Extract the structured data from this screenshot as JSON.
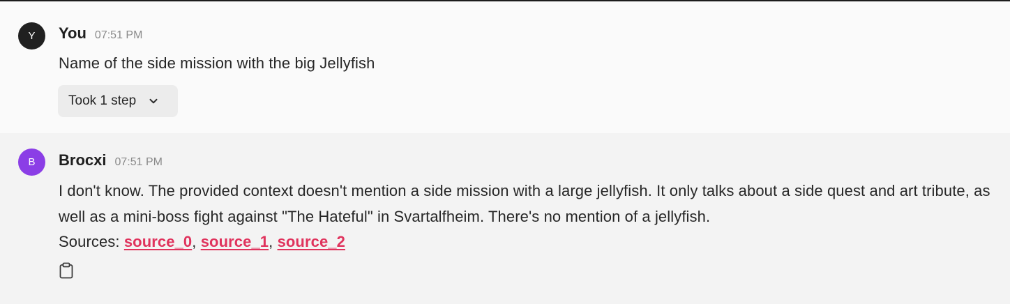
{
  "messages": [
    {
      "author": "You",
      "avatar_letter": "Y",
      "avatar_color": "#202020",
      "time": "07:51 PM",
      "text": "Name of the side mission with the big Jellyfish",
      "steps_label": "Took 1 step",
      "steps_icon": "chevron-down-icon"
    },
    {
      "author": "Brocxi",
      "avatar_letter": "B",
      "avatar_color": "#8b3ee6",
      "time": "07:51 PM",
      "text": "I don't know. The provided context doesn't mention a side mission with a large jellyfish. It only talks about a side quest and art tribute, as well as a mini-boss fight against \"The Hateful\" in Svartalfheim. There's no mention of a jellyfish.",
      "sources_label": "Sources: ",
      "sources": [
        "source_0",
        "source_1",
        "source_2"
      ],
      "sources_sep": ", ",
      "copy_icon": "clipboard-icon"
    }
  ],
  "colors": {
    "link": "#e0335d",
    "user_bg": "#fafafa",
    "bot_bg": "#f3f3f3"
  }
}
